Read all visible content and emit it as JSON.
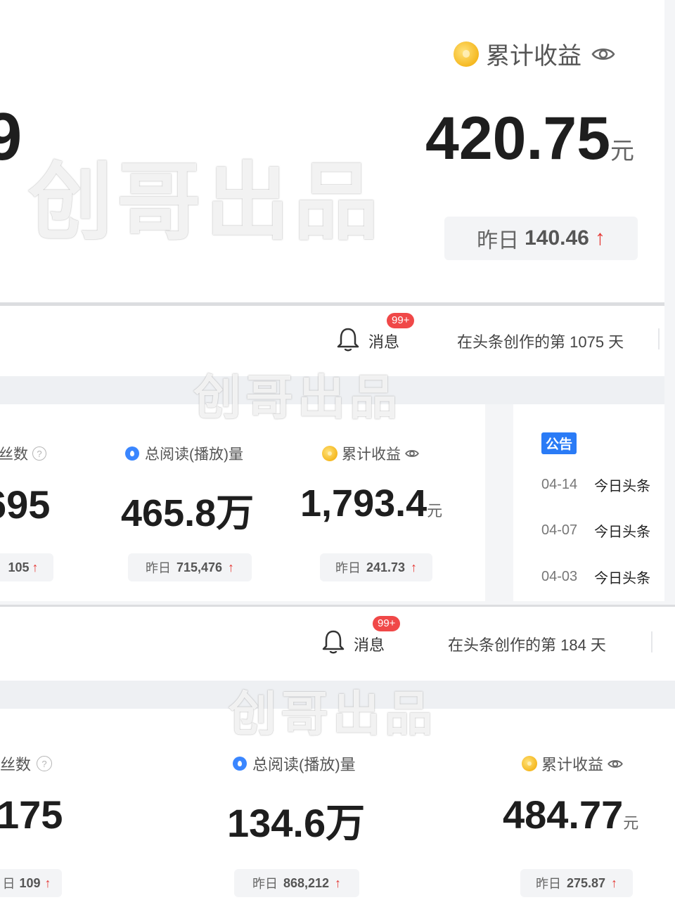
{
  "watermark": "创哥出品",
  "panel1": {
    "partial_digit": "9",
    "earnings_label": "累计收益",
    "earnings_value": "420.75",
    "unit": "元",
    "yesterday_label": "昨日",
    "yesterday_value": "140.46"
  },
  "panel2": {
    "messages_label": "消息",
    "messages_badge": "99+",
    "days_text": "在头条创作的第 1075 天",
    "fans_label": "丝数",
    "fans_value": "695",
    "fans_yesterday": "105",
    "reads_label": "总阅读(播放)量",
    "reads_value": "465.8万",
    "reads_yesterday_label": "昨日",
    "reads_yesterday_value": "715,476",
    "earnings_label": "累计收益",
    "earnings_value": "1,793.4",
    "unit": "元",
    "earnings_yesterday_label": "昨日",
    "earnings_yesterday_value": "241.73",
    "notice_tag": "公告",
    "notices": [
      {
        "date": "04-14",
        "title": "今日头条"
      },
      {
        "date": "04-07",
        "title": "今日头条"
      },
      {
        "date": "04-03",
        "title": "今日头条"
      }
    ]
  },
  "panel3": {
    "messages_label": "消息",
    "messages_badge": "99+",
    "days_text": "在头条创作的第 184 天",
    "fans_label": "粉丝数",
    "fans_value": "175",
    "fans_yesterday_label": "日",
    "fans_yesterday": "109",
    "reads_label": "总阅读(播放)量",
    "reads_value": "134.6万",
    "reads_yesterday_label": "昨日",
    "reads_yesterday_value": "868,212",
    "earnings_label": "累计收益",
    "earnings_value": "484.77",
    "unit": "元",
    "earnings_yesterday_label": "昨日",
    "earnings_yesterday_value": "275.87"
  },
  "icons": {
    "coin": "coin-icon",
    "drop": "read-drop-icon",
    "eye": "eye-icon",
    "bell": "bell-icon",
    "help": "help-circle-icon",
    "arrow_up": "arrow-up-icon"
  },
  "colors": {
    "up_arrow": "#e53935",
    "badge": "#f04848",
    "notice_tag": "#2a7bf6",
    "coin": "#f5b820"
  }
}
